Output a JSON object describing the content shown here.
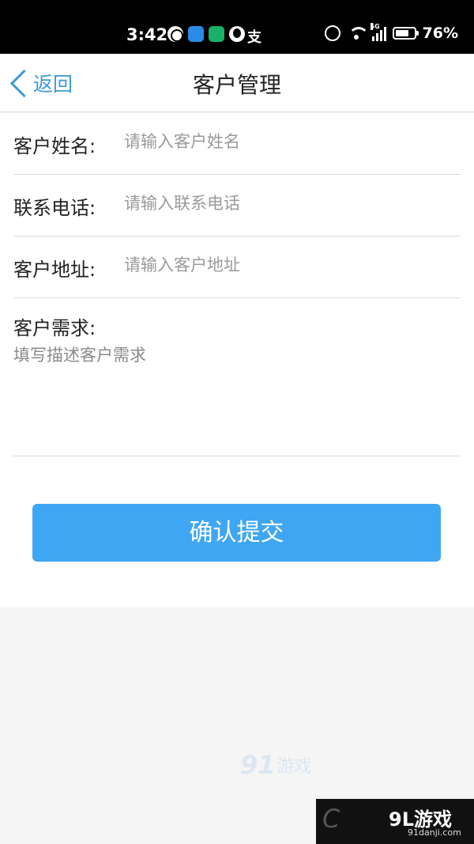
{
  "status_bar": {
    "time": "3:42",
    "pay_icon_text": "支",
    "battery": "76%",
    "battery_level": 0.76,
    "signal_label": "5G",
    "icons": [
      "globe-icon",
      "weather-icon",
      "home-icon",
      "qq-penguin-icon",
      "alipay-icon",
      "alarm-icon",
      "wifi-icon",
      "signal-icon",
      "battery-icon"
    ]
  },
  "header": {
    "back_label": "返回",
    "title": "客户管理"
  },
  "form": {
    "name_label": "客户姓名:",
    "name_placeholder": "请输入客户姓名",
    "phone_label": "联系电话:",
    "phone_placeholder": "请输入联系电话",
    "address_label": "客户地址:",
    "address_placeholder": "请输入客户地址",
    "needs_label": "客户需求:",
    "needs_placeholder": "填写描述客户需求",
    "submit_label": "确认提交"
  },
  "watermark": {
    "logo_number": "91",
    "logo_text": "游戏",
    "url": "91danji.com",
    "corner_logo": "9L游戏"
  },
  "colors": {
    "accent": "#3d9ad8",
    "button": "#3fa6f3",
    "status_bar": "#000000",
    "page_background": "#f5f5f5"
  }
}
